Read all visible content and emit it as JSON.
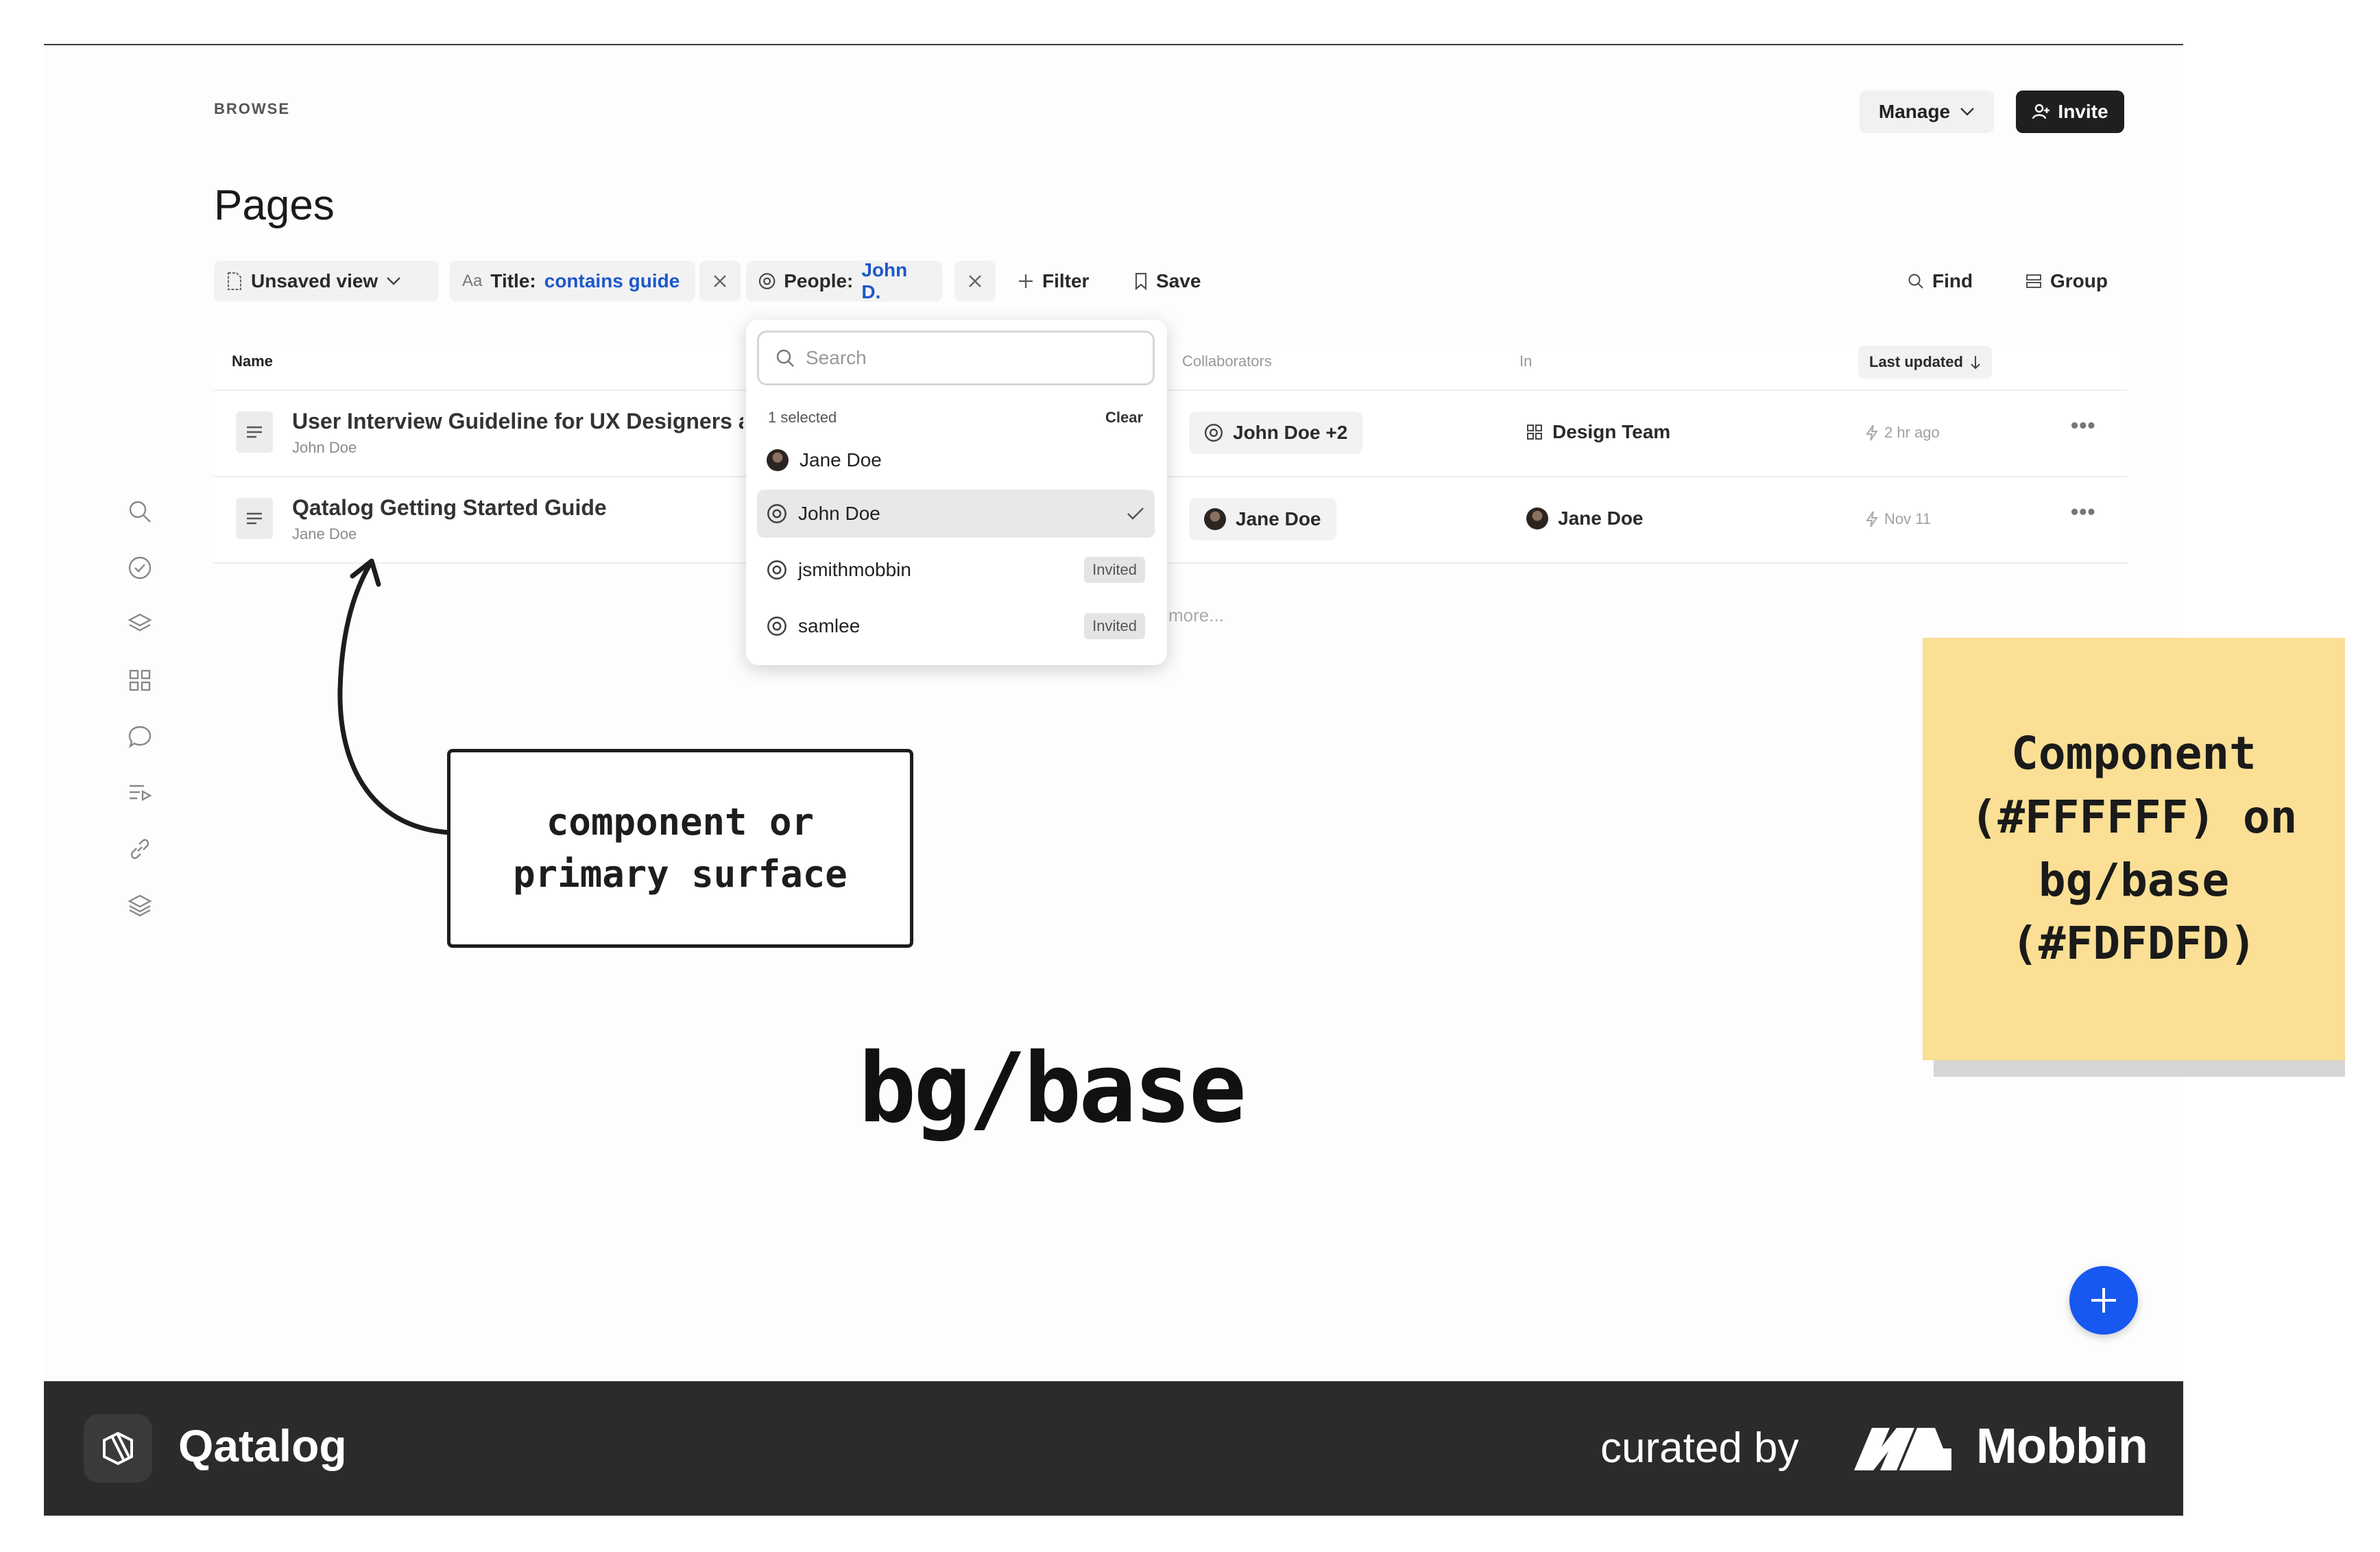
{
  "app": {
    "breadcrumb": "BROWSE",
    "title": "Pages",
    "manage_label": "Manage",
    "invite_label": "Invite"
  },
  "filters": {
    "view_label": "Unsaved view",
    "title_filter_prefix": "Title:",
    "title_filter_value": "contains guide",
    "people_filter_prefix": "People:",
    "people_filter_value": "John D.",
    "filter_label": "Filter",
    "save_label": "Save",
    "find_label": "Find",
    "group_label": "Group"
  },
  "table": {
    "columns": [
      "Name",
      "Collaborators",
      "In",
      "Last updated"
    ],
    "rows": [
      {
        "title": "User Interview Guideline for UX Designers ar",
        "author": "John Doe",
        "collaborators": "John Doe +2",
        "in": "Design Team",
        "updated": "2 hr ago"
      },
      {
        "title": "Qatalog Getting Started Guide",
        "author": "Jane Doe",
        "collaborators": "Jane Doe",
        "in": "Jane Doe",
        "updated": "Nov 11"
      }
    ],
    "more_text": "more..."
  },
  "dropdown": {
    "search_placeholder": "Search",
    "selected_count": "1 selected",
    "clear_label": "Clear",
    "items": [
      {
        "name": "Jane Doe",
        "badge": ""
      },
      {
        "name": "John Doe",
        "badge": "",
        "selected": true
      },
      {
        "name": "jsmithmobbin",
        "badge": "Invited"
      },
      {
        "name": "samlee",
        "badge": "Invited"
      }
    ]
  },
  "annotations": {
    "callout_line1": "component or",
    "callout_line2": "primary surface",
    "bg_label": "bg/base",
    "sticky_line1": "Component",
    "sticky_line2": "(#FFFFFF) on",
    "sticky_line3": "bg/base",
    "sticky_line4": "(#FDFDFD)"
  },
  "footer": {
    "app_name": "Qatalog",
    "curated_by": "curated by",
    "brand": "Mobbin"
  },
  "colors": {
    "accent": "#1d58c9",
    "fab": "#1758f0",
    "surface": "#FFFFFF",
    "bg_base": "#FDFDFD",
    "sticky": "#fadf94",
    "footer": "#2b2b2b"
  }
}
